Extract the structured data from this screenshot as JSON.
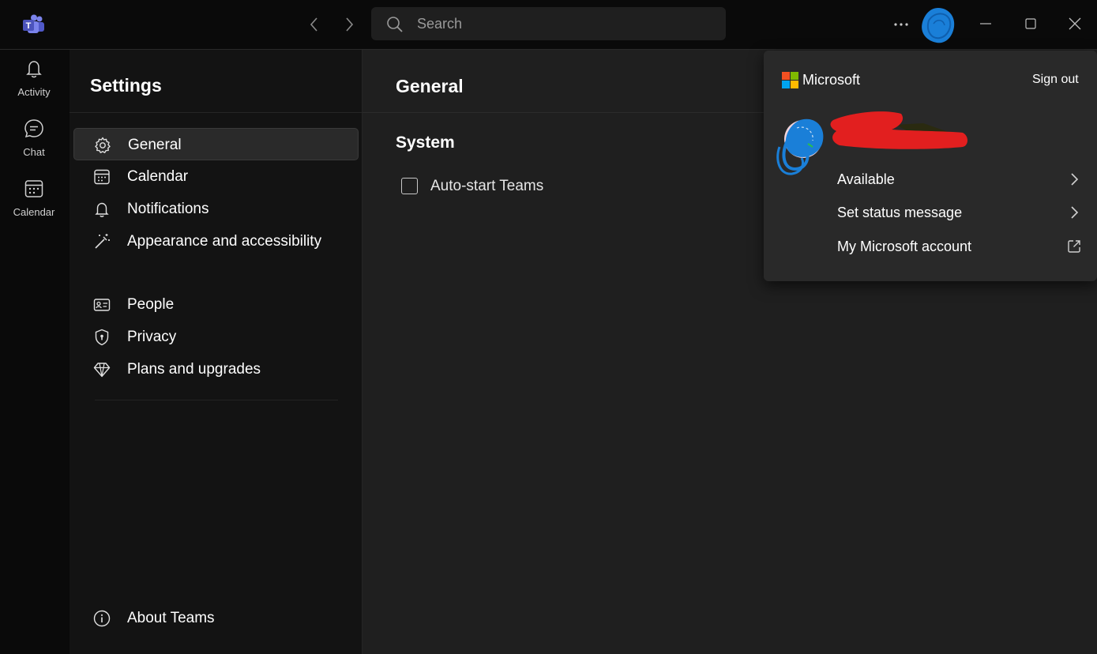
{
  "titlebar": {
    "search_placeholder": "Search",
    "icons": [
      "teams-logo-icon",
      "back-arrow-icon",
      "forward-arrow-icon",
      "search-icon",
      "more-options-icon",
      "user-avatar-icon",
      "minimize-icon",
      "maximize-icon",
      "close-icon"
    ]
  },
  "rail": {
    "items": [
      {
        "label": "Activity",
        "icon": "bell-icon"
      },
      {
        "label": "Chat",
        "icon": "chat-bubble-icon"
      },
      {
        "label": "Calendar",
        "icon": "calendar-icon"
      }
    ]
  },
  "settings": {
    "title": "Settings",
    "menu": [
      {
        "label": "General",
        "icon": "gear-icon",
        "active": true
      },
      {
        "label": "Calendar",
        "icon": "calendar-icon"
      },
      {
        "label": "Notifications",
        "icon": "bell-icon"
      },
      {
        "label": "Appearance and accessibility",
        "icon": "magic-wand-icon"
      },
      {
        "label": "People",
        "icon": "contact-card-icon"
      },
      {
        "label": "Privacy",
        "icon": "shield-icon"
      },
      {
        "label": "Plans and upgrades",
        "icon": "diamond-icon"
      }
    ],
    "footer": {
      "label": "About Teams",
      "icon": "info-icon"
    }
  },
  "main": {
    "title": "General",
    "section_title": "System",
    "checkbox_label": "Auto-start Teams",
    "checkbox_checked": false
  },
  "flyout": {
    "brand": "Microsoft",
    "sign_out": "Sign out",
    "rows": [
      {
        "label": "Available",
        "icon": "chevron-right-icon"
      },
      {
        "label": "Set status message",
        "icon": "chevron-right-icon"
      },
      {
        "label": "My Microsoft account",
        "icon": "external-link-icon"
      }
    ]
  },
  "colors": {
    "background": "#0a0a0a",
    "panel": "#131313",
    "content": "#1f1f1f",
    "flyout": "#292929",
    "redaction_red": "#e21f1f",
    "scribble_blue": "#1a7fd8"
  }
}
